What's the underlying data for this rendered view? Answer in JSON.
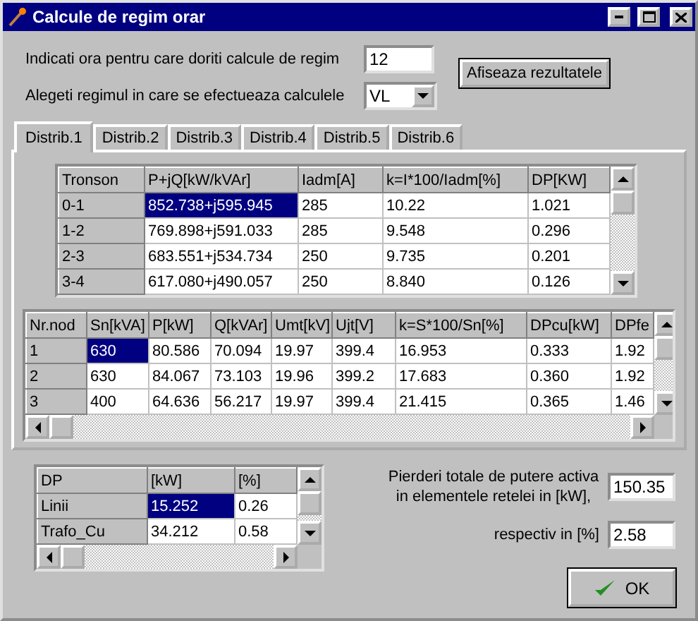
{
  "window": {
    "title": "Calcule de regim orar"
  },
  "hour": {
    "label": "Indicati ora pentru care doriti calcule de regim",
    "value": "12"
  },
  "regime": {
    "label": "Alegeti regimul in care se efectueaza calculele",
    "value": "VL"
  },
  "show_button": {
    "label": "Afiseaza rezultatele"
  },
  "tabs": [
    {
      "label": "Distrib.1",
      "selected": true
    },
    {
      "label": "Distrib.2",
      "selected": false
    },
    {
      "label": "Distrib.3",
      "selected": false
    },
    {
      "label": "Distrib.4",
      "selected": false
    },
    {
      "label": "Distrib.5",
      "selected": false
    },
    {
      "label": "Distrib.6",
      "selected": false
    }
  ],
  "tronson_table": {
    "columns": [
      "Tronson",
      "P+jQ[kW/kVAr]",
      "Iadm[A]",
      "k=I*100/Iadm[%]",
      "DP[KW]"
    ],
    "rows": [
      {
        "cells": [
          {
            "text": "0-1",
            "selected": false
          },
          {
            "text": "852.738+j595.945",
            "selected": true
          },
          {
            "text": "285",
            "selected": false
          },
          {
            "text": "10.22",
            "selected": false
          },
          {
            "text": "1.021",
            "selected": false
          }
        ]
      },
      {
        "cells": [
          {
            "text": "1-2",
            "selected": false
          },
          {
            "text": "769.898+j591.033",
            "selected": false
          },
          {
            "text": "285",
            "selected": false
          },
          {
            "text": "9.548",
            "selected": false
          },
          {
            "text": "0.296",
            "selected": false
          }
        ]
      },
      {
        "cells": [
          {
            "text": "2-3",
            "selected": false
          },
          {
            "text": "683.551+j534.734",
            "selected": false
          },
          {
            "text": "250",
            "selected": false
          },
          {
            "text": "9.735",
            "selected": false
          },
          {
            "text": "0.201",
            "selected": false
          }
        ]
      },
      {
        "cells": [
          {
            "text": "3-4",
            "selected": false
          },
          {
            "text": "617.080+j490.057",
            "selected": false
          },
          {
            "text": "250",
            "selected": false
          },
          {
            "text": "8.840",
            "selected": false
          },
          {
            "text": "0.126",
            "selected": false
          }
        ]
      }
    ]
  },
  "node_table": {
    "columns": [
      "Nr.nod",
      "Sn[kVA]",
      "P[kW]",
      "Q[kVAr]",
      "Umt[kV]",
      "Ujt[V]",
      "k=S*100/Sn[%]",
      "DPcu[kW]",
      "DPfe"
    ],
    "rows": [
      {
        "cells": [
          {
            "text": "1",
            "selected": false
          },
          {
            "text": "630",
            "selected": true
          },
          {
            "text": "80.586",
            "selected": false
          },
          {
            "text": "70.094",
            "selected": false
          },
          {
            "text": "19.97",
            "selected": false
          },
          {
            "text": "399.4",
            "selected": false
          },
          {
            "text": "16.953",
            "selected": false
          },
          {
            "text": "0.333",
            "selected": false
          },
          {
            "text": "1.92",
            "selected": false
          }
        ]
      },
      {
        "cells": [
          {
            "text": "2",
            "selected": false
          },
          {
            "text": "630",
            "selected": false
          },
          {
            "text": "84.067",
            "selected": false
          },
          {
            "text": "73.103",
            "selected": false
          },
          {
            "text": "19.96",
            "selected": false
          },
          {
            "text": "399.2",
            "selected": false
          },
          {
            "text": "17.683",
            "selected": false
          },
          {
            "text": "0.360",
            "selected": false
          },
          {
            "text": "1.92",
            "selected": false
          }
        ]
      },
      {
        "cells": [
          {
            "text": "3",
            "selected": false
          },
          {
            "text": "400",
            "selected": false
          },
          {
            "text": "64.636",
            "selected": false
          },
          {
            "text": "56.217",
            "selected": false
          },
          {
            "text": "19.97",
            "selected": false
          },
          {
            "text": "399.4",
            "selected": false
          },
          {
            "text": "21.415",
            "selected": false
          },
          {
            "text": "0.365",
            "selected": false
          },
          {
            "text": "1.46",
            "selected": false
          }
        ]
      }
    ]
  },
  "losses_table": {
    "columns": [
      "DP",
      "[kW]",
      "[%]"
    ],
    "rows": [
      {
        "cells": [
          {
            "text": "Linii",
            "selected": false
          },
          {
            "text": "15.252",
            "selected": true
          },
          {
            "text": "0.26",
            "selected": false
          }
        ]
      },
      {
        "cells": [
          {
            "text": "Trafo_Cu",
            "selected": false
          },
          {
            "text": "34.212",
            "selected": false
          },
          {
            "text": "0.58",
            "selected": false
          }
        ]
      }
    ]
  },
  "total_losses": {
    "label": "Pierderi totale de putere activa in elementele retelei in [kW],",
    "value": "150.35"
  },
  "percent": {
    "label": "respectiv in [%]",
    "value": "2.58"
  },
  "ok_button": {
    "label": "OK"
  }
}
